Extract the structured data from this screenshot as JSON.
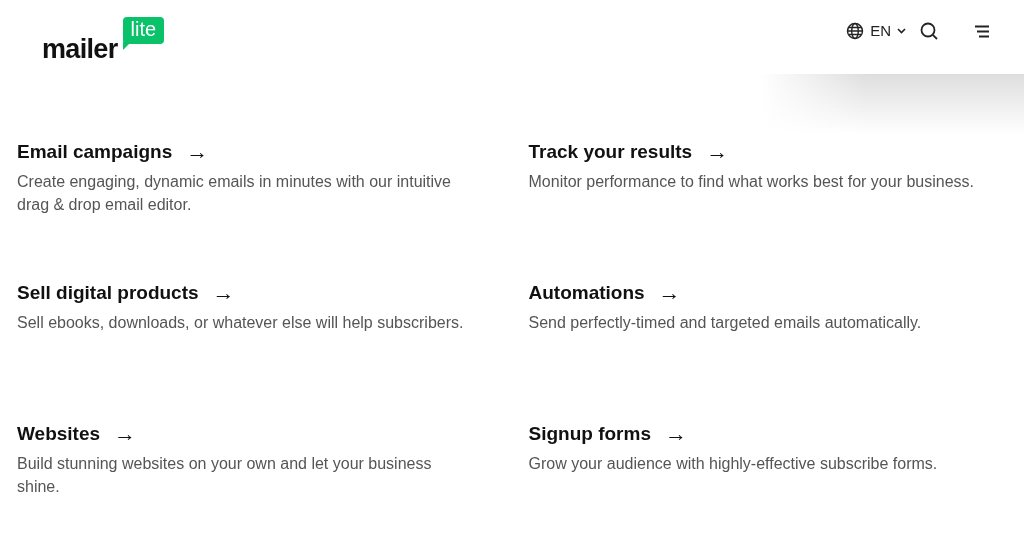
{
  "logo": {
    "word": "mailer",
    "badge": "lite"
  },
  "header": {
    "language": "EN"
  },
  "features": [
    {
      "title": "Email campaigns",
      "arrow": "→",
      "description": "Create engaging, dynamic emails in minutes with our intuitive drag & drop email editor."
    },
    {
      "title": "Track your results",
      "arrow": "→",
      "description": "Monitor performance to find what works best for your business."
    },
    {
      "title": "Sell digital products",
      "arrow": "→",
      "description": "Sell ebooks, downloads, or whatever else will help subscribers."
    },
    {
      "title": "Automations",
      "arrow": "→",
      "description": "Send perfectly-timed and targeted emails automatically."
    },
    {
      "title": "Websites",
      "arrow": "→",
      "description": "Build stunning websites on your own and let your business shine."
    },
    {
      "title": "Signup forms",
      "arrow": "→",
      "description": "Grow your audience with highly-effective subscribe forms."
    }
  ]
}
